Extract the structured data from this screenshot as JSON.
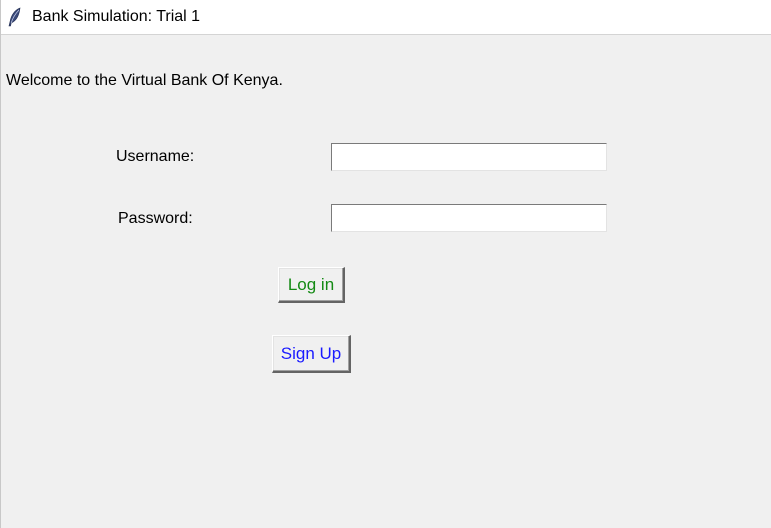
{
  "window": {
    "title": "Bank Simulation: Trial 1",
    "icon": "feather-icon"
  },
  "main": {
    "welcome_text": "Welcome to the Virtual Bank Of Kenya.",
    "username_label": "Username:",
    "username_value": "",
    "password_label": "Password:",
    "password_value": "",
    "login_label": "Log in",
    "signup_label": "Sign Up"
  },
  "colors": {
    "background": "#f0f0f0",
    "login_text": "#148a14",
    "signup_text": "#1a1aff"
  }
}
